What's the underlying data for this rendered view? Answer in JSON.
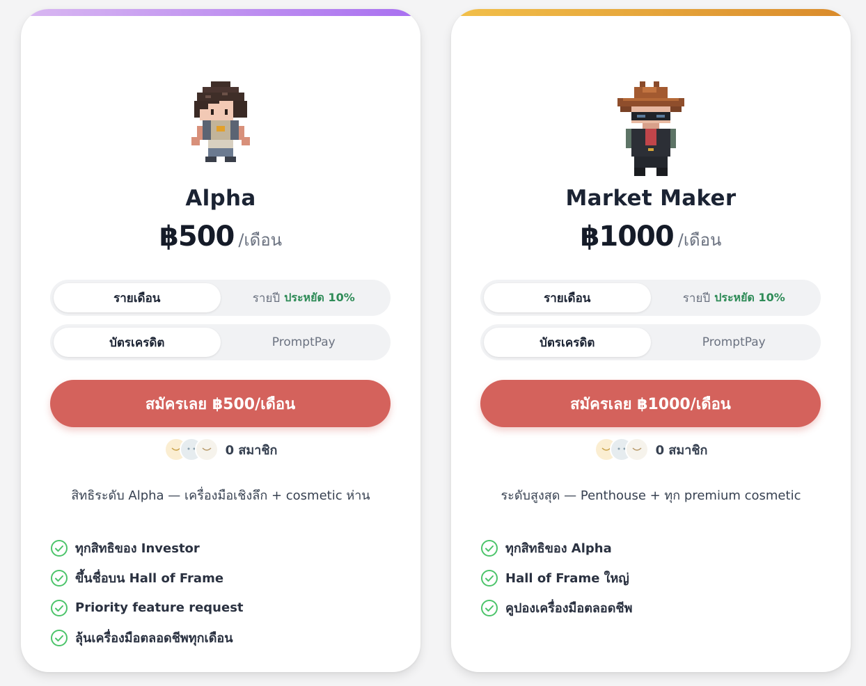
{
  "plans": [
    {
      "id": "alpha",
      "name": "Alpha",
      "price": "฿500",
      "period": "/เดือน",
      "billing": {
        "monthly": "รายเดือน",
        "yearly": "รายปี",
        "yearly_save": "ประหยัด 10%",
        "selected": "รายเดือน"
      },
      "payment": {
        "card": "บัตรเครดิต",
        "promptpay": "PromptPay",
        "selected": "บัตรเครดิต"
      },
      "cta_label": "สมัครเลย ฿500/เดือน",
      "member_count": "0 สมาชิก",
      "description": "สิทธิระดับ Alpha — เครื่องมือเชิงลึก + cosmetic ห่าน",
      "features": [
        "ทุกสิทธิของ Investor",
        "ขึ้นชื่อบน Hall of Frame",
        "Priority feature request",
        "ลุ้นเครื่องมือตลอดชีพทุกเดือน"
      ],
      "accent_gradient": [
        "#d9b8f1",
        "#a86ff0"
      ]
    },
    {
      "id": "market-maker",
      "name": "Market Maker",
      "price": "฿1000",
      "period": "/เดือน",
      "billing": {
        "monthly": "รายเดือน",
        "yearly": "รายปี",
        "yearly_save": "ประหยัด 10%",
        "selected": "รายเดือน"
      },
      "payment": {
        "card": "บัตรเครดิต",
        "promptpay": "PromptPay",
        "selected": "บัตรเครดิต"
      },
      "cta_label": "สมัครเลย ฿1000/เดือน",
      "member_count": "0 สมาชิก",
      "description": "ระดับสูงสุด — Penthouse + ทุก premium cosmetic",
      "features": [
        "ทุกสิทธิของ Alpha",
        "Hall of Frame ใหญ่",
        "คูปองเครื่องมือตลอดชีพ"
      ],
      "accent_gradient": [
        "#f2c04a",
        "#d98a2b"
      ]
    }
  ],
  "colors": {
    "cta": "#d4625c",
    "check": "#4cc46a",
    "save_text": "#2e8b57"
  },
  "icons": {
    "feature": "check-circle-icon",
    "avatar_alpha": "pixel-character-brown-hair",
    "avatar_mm": "pixel-character-cowboy-hat"
  }
}
